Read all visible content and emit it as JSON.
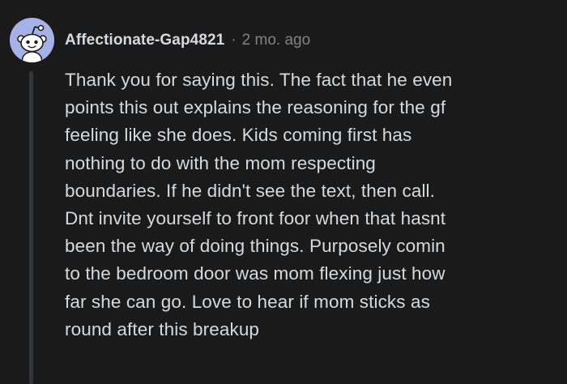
{
  "comment": {
    "author": "Affectionate-Gap4821",
    "separator": "·",
    "age": "2 mo. ago",
    "avatar": {
      "icon": "snoo-avatar-icon",
      "bg_color": "#a6b1e6"
    },
    "body_lines": [
      "Thank you for saying this. The fact that he even",
      "points this out explains the reasoning for the gf",
      "feeling like she does. Kids coming first has",
      "nothing to do with the mom respecting",
      "boundaries. If he didn't see the text, then call.",
      "Dnt invite yourself to front foor when that hasnt",
      "been the way of doing things. Purposely comin",
      "to the bedroom door was mom flexing just how",
      "far she can go. Love to hear if mom sticks as",
      "round after this breakup"
    ]
  },
  "colors": {
    "background": "#1a1a1b",
    "text": "#d7dadc",
    "muted": "#818384",
    "thread_line": "#343536"
  }
}
